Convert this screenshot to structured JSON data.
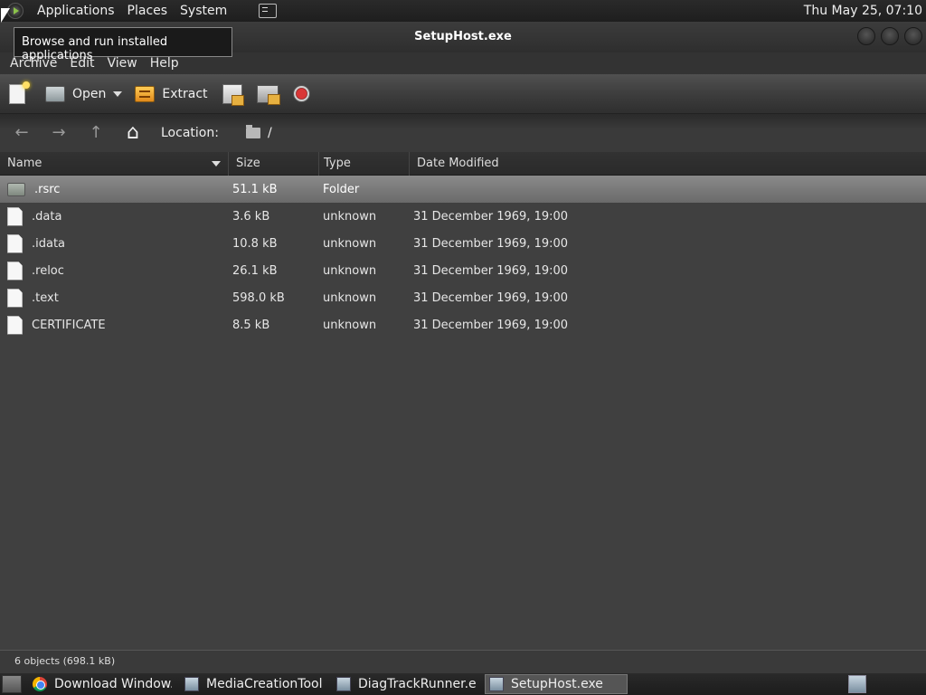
{
  "top_panel": {
    "menus": [
      "Applications",
      "Places",
      "System"
    ],
    "clock": "Thu May 25, 07:10"
  },
  "tooltip": {
    "text": "Browse and run installed applications"
  },
  "window": {
    "title": "SetupHost.exe",
    "menubar": [
      "Archive",
      "Edit",
      "View",
      "Help"
    ],
    "toolbar": {
      "open_label": "Open",
      "extract_label": "Extract"
    },
    "location": {
      "label": "Location:",
      "path": "/"
    },
    "columns": [
      "Name",
      "Size",
      "Type",
      "Date Modified"
    ],
    "files": [
      {
        "name": ".rsrc",
        "size": "51.1 kB",
        "type": "Folder",
        "date": "",
        "icon": "folder-icon"
      },
      {
        "name": ".data",
        "size": "3.6 kB",
        "type": "unknown",
        "date": "31 December 1969, 19:00",
        "icon": "file-icon"
      },
      {
        "name": ".idata",
        "size": "10.8 kB",
        "type": "unknown",
        "date": "31 December 1969, 19:00",
        "icon": "file-icon"
      },
      {
        "name": ".reloc",
        "size": "26.1 kB",
        "type": "unknown",
        "date": "31 December 1969, 19:00",
        "icon": "file-icon"
      },
      {
        "name": ".text",
        "size": "598.0 kB",
        "type": "unknown",
        "date": "31 December 1969, 19:00",
        "icon": "file-icon"
      },
      {
        "name": "CERTIFICATE",
        "size": "8.5 kB",
        "type": "unknown",
        "date": "31 December 1969, 19:00",
        "icon": "file-icon"
      }
    ],
    "status": "6 objects (698.1 kB)"
  },
  "taskbar": {
    "tasks": [
      "Download Window...",
      "MediaCreationTool...",
      "DiagTrackRunner.exe",
      "SetupHost.exe"
    ]
  }
}
